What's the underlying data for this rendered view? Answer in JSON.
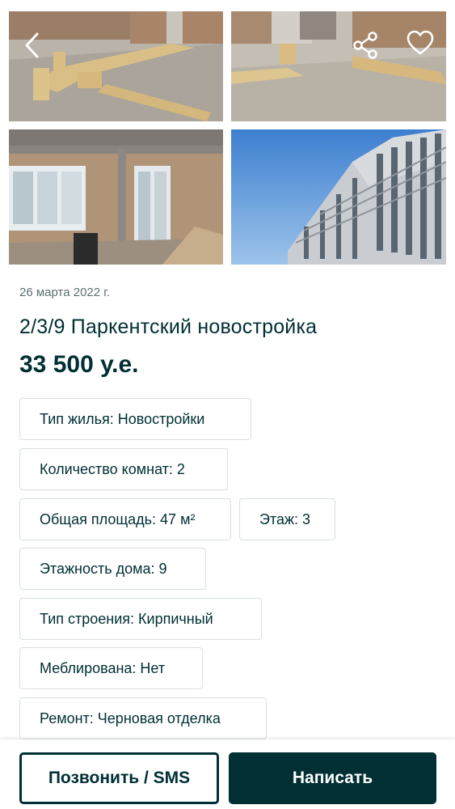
{
  "gallery": {
    "photos": [
      {
        "alt": "photo-1"
      },
      {
        "alt": "photo-2"
      },
      {
        "alt": "photo-3"
      },
      {
        "alt": "photo-4"
      }
    ],
    "icons": {
      "back": "chevron-left-icon",
      "share": "share-icon",
      "favorite": "heart-icon"
    }
  },
  "listing": {
    "date": "26 марта 2022 г.",
    "title": "2/3/9 Паркентский новостройка",
    "price": "33 500 у.е."
  },
  "params": [
    {
      "label": "Тип жилья: Новостройки"
    },
    {
      "label": "Количество комнат: 2"
    },
    {
      "label": "Общая площадь: 47 м²"
    },
    {
      "label": "Этаж: 3"
    },
    {
      "label": "Этажность дома: 9"
    },
    {
      "label": "Тип строения: Кирпичный"
    },
    {
      "label": "Меблирована: Нет"
    },
    {
      "label": "Ремонт: Черновая отделка"
    }
  ],
  "actions": {
    "call_label": "Позвонить / SMS",
    "write_label": "Написать"
  },
  "colors": {
    "primary": "#002f34",
    "border": "#d8dfe0",
    "muted": "#5b6f71"
  }
}
